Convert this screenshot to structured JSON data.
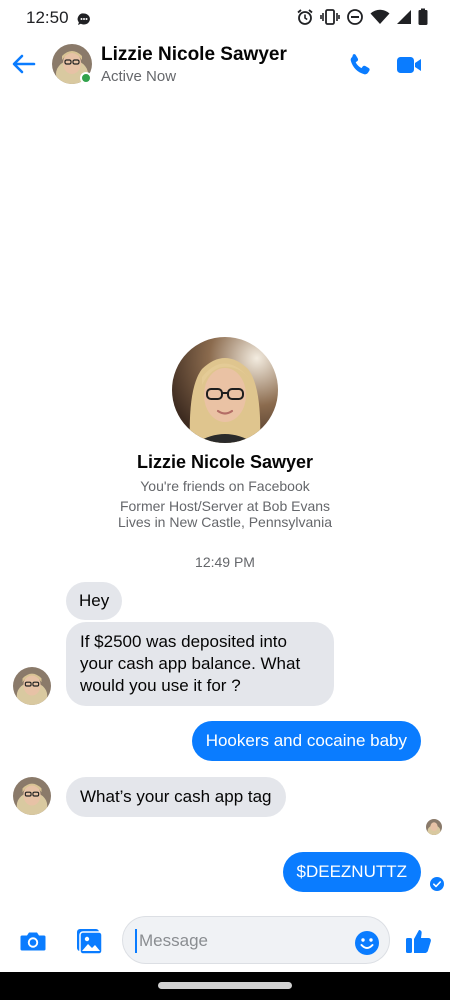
{
  "status_bar": {
    "time": "12:50",
    "icons": [
      "chat-bubble-icon",
      "alarm-icon",
      "vibrate-icon",
      "dnd-icon",
      "wifi-icon",
      "signal-icon",
      "battery-icon"
    ]
  },
  "header": {
    "name": "Lizzie Nicole Sawyer",
    "status": "Active Now",
    "accent": "#0a7cff",
    "online_color": "#31a24c"
  },
  "profile": {
    "name": "Lizzie Nicole Sawyer",
    "friends_line": "You're friends on Facebook",
    "work_line": "Former Host/Server at Bob Evans",
    "location_line": "Lives in New Castle, Pennsylvania"
  },
  "conversation": {
    "timestamp": "12:49 PM",
    "messages": [
      {
        "from": "them",
        "text": "Hey"
      },
      {
        "from": "them",
        "text": "If $2500 was deposited into your cash app balance. What would you use it for ?"
      },
      {
        "from": "me",
        "text": "Hookers and cocaine baby"
      },
      {
        "from": "them",
        "text": "What’s your cash app tag"
      },
      {
        "from": "me",
        "text": "$DEEZNUTTZ"
      }
    ]
  },
  "composer": {
    "placeholder": "Message",
    "value": ""
  }
}
